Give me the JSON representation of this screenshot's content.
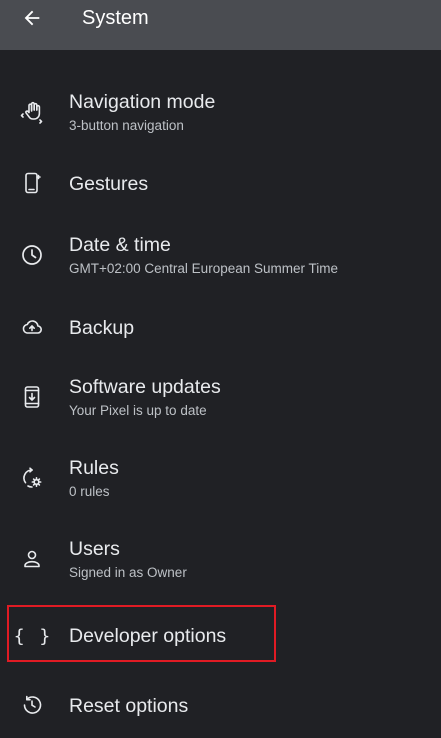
{
  "app_bar": {
    "title": "System",
    "back_icon": "arrow-back-icon"
  },
  "items": [
    {
      "icon": "touch-gesture-icon",
      "title": "Navigation mode",
      "subtitle": "3-button navigation"
    },
    {
      "icon": "phone-gesture-icon",
      "title": "Gestures",
      "subtitle": ""
    },
    {
      "icon": "clock-icon",
      "title": "Date & time",
      "subtitle": "GMT+02:00 Central European Summer Time"
    },
    {
      "icon": "cloud-upload-icon",
      "title": "Backup",
      "subtitle": ""
    },
    {
      "icon": "system-update-icon",
      "title": "Software updates",
      "subtitle": "Your Pixel is up to date"
    },
    {
      "icon": "rules-icon",
      "title": "Rules",
      "subtitle": "0 rules"
    },
    {
      "icon": "person-icon",
      "title": "Users",
      "subtitle": "Signed in as Owner"
    },
    {
      "icon": "code-braces-icon",
      "title": "Developer options",
      "subtitle": "",
      "icon_text": "{ }"
    },
    {
      "icon": "history-icon",
      "title": "Reset options",
      "subtitle": ""
    }
  ],
  "colors": {
    "background": "#202125",
    "app_bar": "#4a4c51",
    "title_text": "#e8eaed",
    "subtitle_text": "#bdc1c6",
    "highlight": "#e01b24"
  }
}
